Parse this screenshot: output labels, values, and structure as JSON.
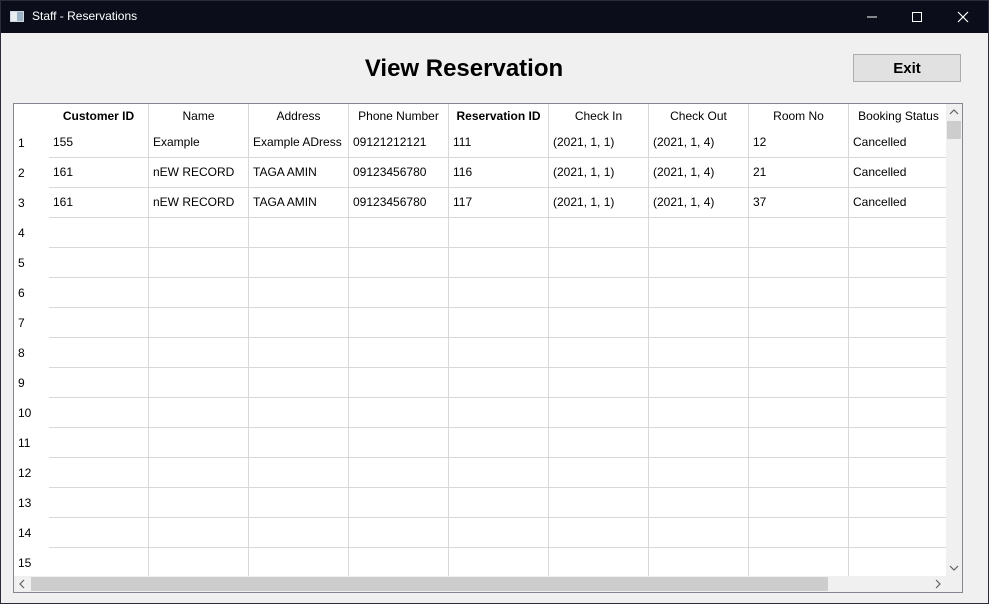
{
  "window": {
    "title": "Staff - Reservations"
  },
  "page": {
    "heading": "View Reservation",
    "exit_label": "Exit"
  },
  "table": {
    "columns": [
      {
        "label": "Customer ID",
        "bold": true
      },
      {
        "label": "Name",
        "bold": false
      },
      {
        "label": "Address",
        "bold": false
      },
      {
        "label": "Phone Number",
        "bold": false
      },
      {
        "label": "Reservation ID",
        "bold": true
      },
      {
        "label": "Check In",
        "bold": false
      },
      {
        "label": "Check Out",
        "bold": false
      },
      {
        "label": "Room No",
        "bold": false
      },
      {
        "label": "Booking Status",
        "bold": false
      }
    ],
    "row_numbers": [
      "1",
      "2",
      "3",
      "4",
      "5",
      "6",
      "7",
      "8",
      "9",
      "10",
      "11",
      "12",
      "13",
      "14",
      "15"
    ],
    "rows": [
      [
        "155",
        "Example",
        "Example ADress",
        "09121212121",
        "111",
        "(2021, 1, 1)",
        "(2021, 1, 4)",
        "12",
        "Cancelled"
      ],
      [
        "161",
        "nEW RECORD",
        "TAGA AMIN",
        "09123456780",
        "116",
        "(2021, 1, 1)",
        "(2021, 1, 4)",
        "21",
        "Cancelled"
      ],
      [
        "161",
        "nEW RECORD",
        "TAGA AMIN",
        "09123456780",
        "117",
        "(2021, 1, 1)",
        "(2021, 1, 4)",
        "37",
        "Cancelled"
      ]
    ]
  },
  "icons": {
    "app": "app-window-icon",
    "minimize": "minimize-icon",
    "maximize": "maximize-icon",
    "close": "close-icon",
    "scroll_up": "chevron-up-icon",
    "scroll_down": "chevron-down-icon",
    "scroll_left": "chevron-left-icon",
    "scroll_right": "chevron-right-icon"
  }
}
